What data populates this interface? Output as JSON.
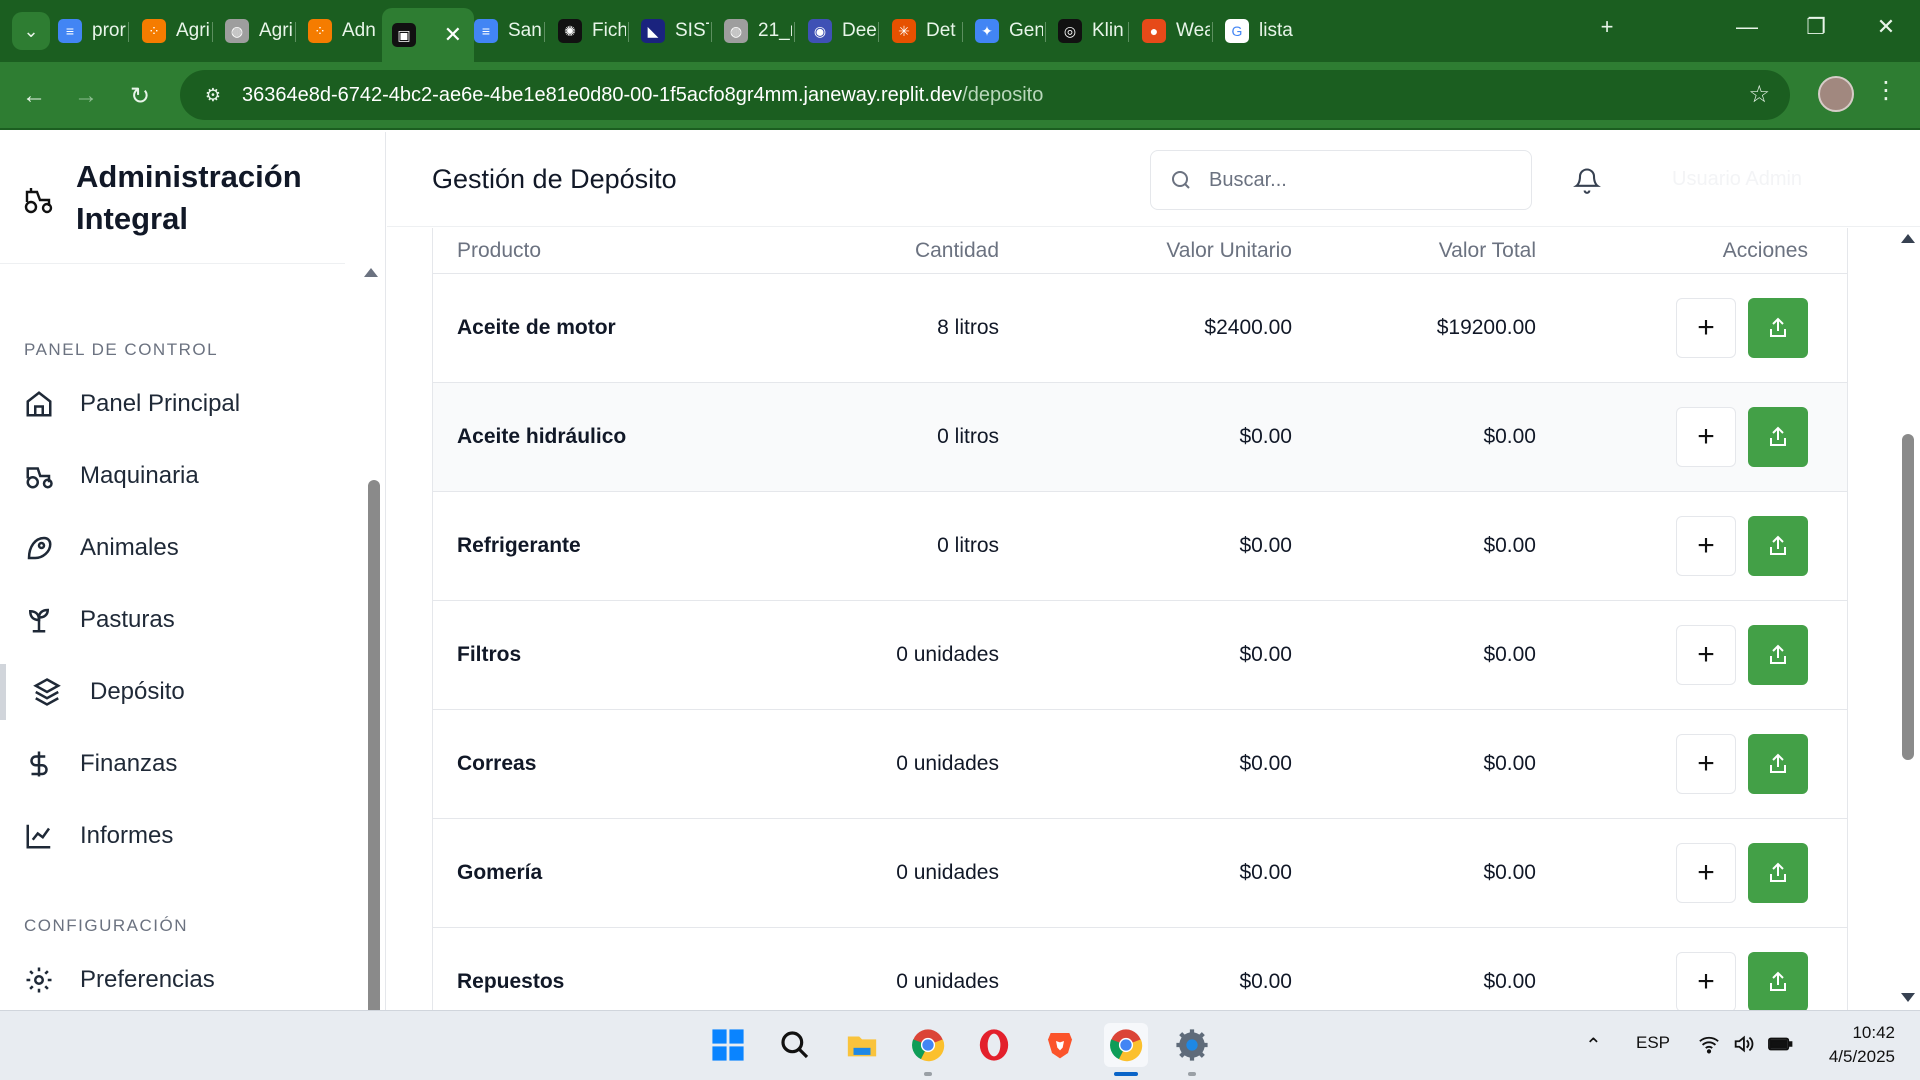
{
  "browser": {
    "tabs": [
      {
        "label": "pror",
        "color": "#4285f4",
        "glyph": "≡"
      },
      {
        "label": "Agri",
        "color": "#f57c00",
        "glyph": "⁘"
      },
      {
        "label": "Agri",
        "color": "#9e9e9e",
        "glyph": "◍"
      },
      {
        "label": "Adn",
        "color": "#f57c00",
        "glyph": "⁘"
      },
      {
        "label": "",
        "color": "#111111",
        "glyph": "▣"
      },
      {
        "label": "San",
        "color": "#4285f4",
        "glyph": "≡"
      },
      {
        "label": "Fich",
        "color": "#111111",
        "glyph": "✺"
      },
      {
        "label": "SIST",
        "color": "#1a237e",
        "glyph": "◣"
      },
      {
        "label": "21_r",
        "color": "#9e9e9e",
        "glyph": "◍"
      },
      {
        "label": "Dee",
        "color": "#3f51b5",
        "glyph": "◉"
      },
      {
        "label": "Det",
        "color": "#e65100",
        "glyph": "✳"
      },
      {
        "label": "Gen",
        "color": "#4285f4",
        "glyph": "✦"
      },
      {
        "label": "Klin",
        "color": "#111111",
        "glyph": "◎"
      },
      {
        "label": "Wea",
        "color": "#e64a19",
        "glyph": "●"
      },
      {
        "label": "lista",
        "color": "#ffffff",
        "glyph": "G"
      }
    ],
    "new_tab": "+",
    "url_host": "36364e8d-6742-4bc2-ae6e-4be1e81e0d80-00-1f5acfo8gr4mm.janeway.replit.dev",
    "url_path": "/deposito"
  },
  "sidebar": {
    "brand": "Administración Integral",
    "section_control": "PANEL DE CONTROL",
    "section_config": "CONFIGURACIÓN",
    "items": [
      {
        "label": "Panel Principal",
        "icon": "home-icon"
      },
      {
        "label": "Maquinaria",
        "icon": "tractor-icon"
      },
      {
        "label": "Animales",
        "icon": "animal-icon"
      },
      {
        "label": "Pasturas",
        "icon": "sprout-icon"
      },
      {
        "label": "Depósito",
        "icon": "boxes-icon"
      },
      {
        "label": "Finanzas",
        "icon": "dollar-icon"
      },
      {
        "label": "Informes",
        "icon": "chart-icon"
      },
      {
        "label": "Preferencias",
        "icon": "gear-icon"
      }
    ]
  },
  "header": {
    "title": "Gestión de Depósito",
    "search_placeholder": "Buscar...",
    "user_faint": "Usuario Admin"
  },
  "table": {
    "columns": [
      "Producto",
      "Cantidad",
      "Valor Unitario",
      "Valor Total",
      "Acciones"
    ],
    "rows": [
      {
        "product": "Aceite de motor",
        "qty": "8 litros",
        "unit": "$2400.00",
        "total": "$19200.00"
      },
      {
        "product": "Aceite hidráulico",
        "qty": "0 litros",
        "unit": "$0.00",
        "total": "$0.00"
      },
      {
        "product": "Refrigerante",
        "qty": "0 litros",
        "unit": "$0.00",
        "total": "$0.00"
      },
      {
        "product": "Filtros",
        "qty": "0 unidades",
        "unit": "$0.00",
        "total": "$0.00"
      },
      {
        "product": "Correas",
        "qty": "0 unidades",
        "unit": "$0.00",
        "total": "$0.00"
      },
      {
        "product": "Gomería",
        "qty": "0 unidades",
        "unit": "$0.00",
        "total": "$0.00"
      },
      {
        "product": "Repuestos",
        "qty": "0 unidades",
        "unit": "$0.00",
        "total": "$0.00"
      }
    ],
    "add_label": "+"
  },
  "taskbar": {
    "lang": "ESP",
    "time": "10:42",
    "date": "4/5/2025"
  },
  "colors": {
    "chrome_dark": "#1b5e20",
    "chrome": "#2e7d32",
    "accent_green": "#43a047"
  }
}
